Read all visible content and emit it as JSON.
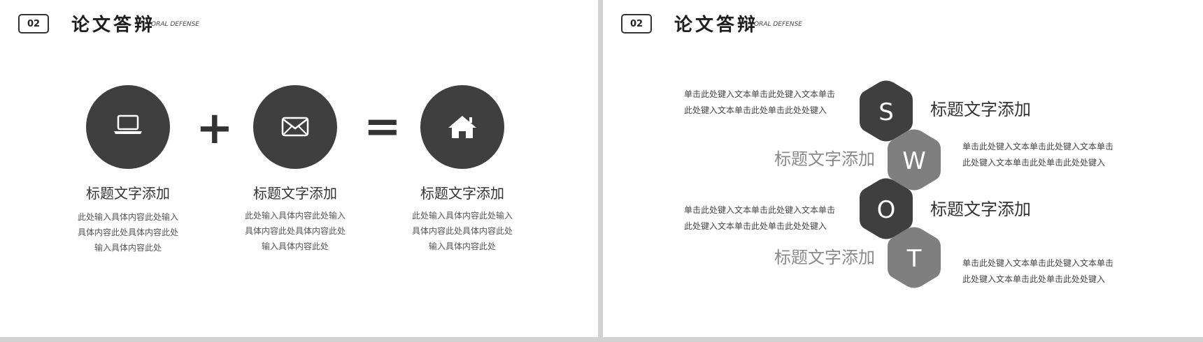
{
  "header": {
    "badge": "02",
    "title": "论文答辩",
    "subtitle": "ORAL DEFENSE"
  },
  "left_slide": {
    "operators": {
      "plus": "+",
      "equals": "="
    },
    "items": [
      {
        "icon": "laptop-icon",
        "title": "标题文字添加",
        "lines": [
          "此处输入具体内容此处输入",
          "具体内容此处具体内容此处",
          "输入具体内容此处"
        ]
      },
      {
        "icon": "envelope-icon",
        "title": "标题文字添加",
        "lines": [
          "此处输入具体内容此处输入",
          "具体内容此处具体内容此处",
          "输入具体内容此处"
        ]
      },
      {
        "icon": "house-icon",
        "title": "标题文字添加",
        "lines": [
          "此处输入具体内容此处输入",
          "具体内容此处具体内容此处",
          "输入具体内容此处"
        ]
      }
    ]
  },
  "right_slide": {
    "swot": [
      {
        "letter": "S",
        "title": "标题文字添加",
        "lines": [
          "单击此处键入文本单击此处键入文本单击",
          "此处键入文本单击此处单击此处处键入"
        ]
      },
      {
        "letter": "W",
        "title": "标题文字添加",
        "lines": [
          "单击此处键入文本单击此处键入文本单击",
          "此处键入文本单击此处单击此处处键入"
        ]
      },
      {
        "letter": "O",
        "title": "标题文字添加",
        "lines": [
          "单击此处键入文本单击此处键入文本单击",
          "此处键入文本单击此处单击此处处键入"
        ]
      },
      {
        "letter": "T",
        "title": "标题文字添加",
        "lines": [
          "单击此处键入文本单击此处键入文本单击",
          "此处键入文本单击此处单击此处处键入"
        ]
      }
    ]
  },
  "colors": {
    "dark": "#3f3f3f",
    "medium": "#7f7f7f",
    "separator": "#d2d2d2"
  }
}
